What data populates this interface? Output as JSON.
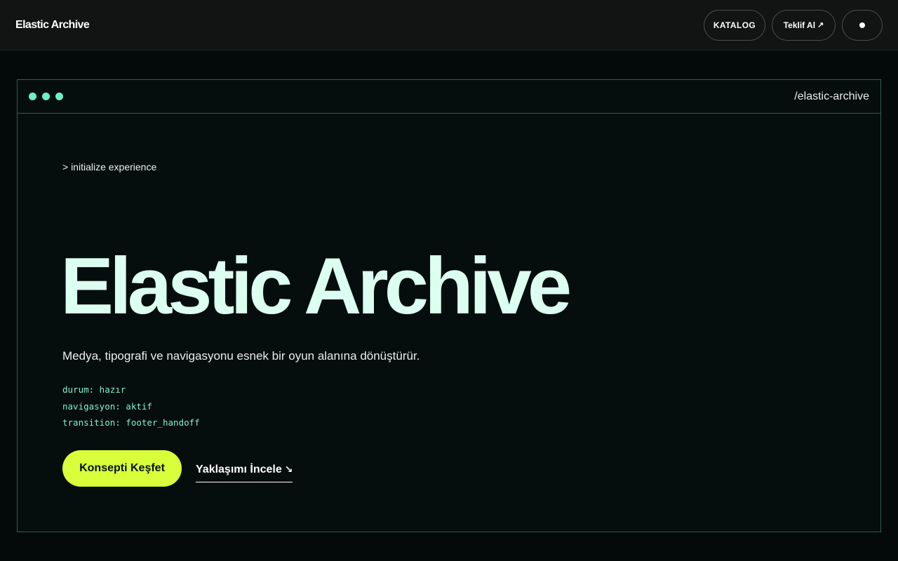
{
  "header": {
    "brand": "Elastic Archive",
    "nav": {
      "katalog": "KATALOG",
      "teklif": "Teklif Al",
      "teklif_arrow": "↗"
    }
  },
  "window": {
    "path": "/elastic-archive"
  },
  "hero": {
    "prompt": "> initialize experience",
    "title": "Elastic Archive",
    "tagline": "Medya, tipografi ve navigasyonu esnek bir oyun alanına dönüştürür.",
    "meta": [
      "durum: hazır",
      "navigasyon: aktif",
      "transition: footer_handoff"
    ],
    "primary_cta": "Konsepti Keşfet",
    "secondary_cta": "Yaklaşımı İncele",
    "secondary_arrow": "↘"
  },
  "colors": {
    "accent": "#d9ff3a",
    "terminal_green": "#7ff5c8",
    "hero_text": "#dbfff0",
    "frame_border": "#2f5e50"
  }
}
